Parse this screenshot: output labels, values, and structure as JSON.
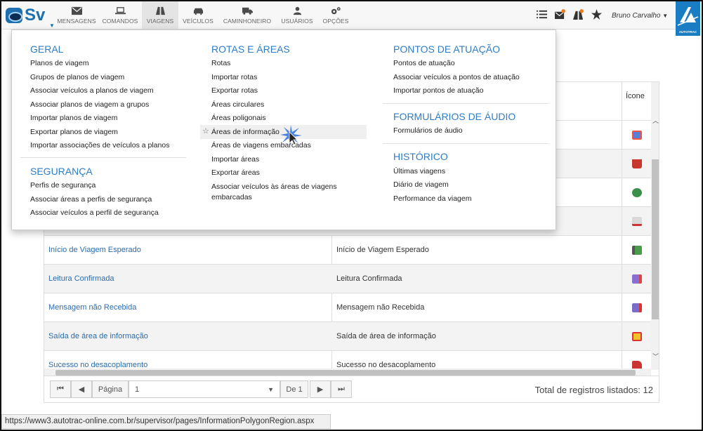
{
  "nav": {
    "logo_text": "Sv",
    "items": [
      {
        "label": "MENSAGENS",
        "icon": "envelope-icon"
      },
      {
        "label": "COMANDOS",
        "icon": "laptop-icon"
      },
      {
        "label": "VIAGENS",
        "icon": "road-icon"
      },
      {
        "label": "VEÍCULOS",
        "icon": "car-icon"
      },
      {
        "label": "CAMINHONEIRO",
        "icon": "truck-icon"
      },
      {
        "label": "USUÁRIOS",
        "icon": "user-icon"
      },
      {
        "label": "OPÇÕES",
        "icon": "gears-icon"
      }
    ],
    "user_name": "Bruno Carvalho",
    "brand_text": "AUTOTRAC"
  },
  "menu": {
    "geral": {
      "title": "GERAL",
      "items": [
        "Planos de viagem",
        "Grupos de planos de viagem",
        "Associar veículos a planos de viagem",
        "Associar planos de viagem a grupos",
        "Importar planos de viagem",
        "Exportar planos de viagem",
        "Importar associações de veículos a planos"
      ]
    },
    "seguranca": {
      "title": "SEGURANÇA",
      "items": [
        "Perfis de segurança",
        "Associar áreas a perfis de segurança",
        "Associar veículos a perfil de segurança"
      ]
    },
    "rotas": {
      "title": "ROTAS E ÁREAS",
      "items": [
        "Rotas",
        "Importar rotas",
        "Exportar rotas",
        "Áreas circulares",
        "Áreas poligonais",
        "Áreas de informação",
        "Áreas de viagens embarcadas",
        "Importar áreas",
        "Exportar áreas",
        "Associar veículos às áreas de viagens",
        "embarcadas"
      ]
    },
    "pontos": {
      "title": "PONTOS DE ATUAÇÃO",
      "items": [
        "Pontos de atuação",
        "Associar veículos a pontos de atuação",
        "Importar pontos de atuação"
      ]
    },
    "formularios": {
      "title": "FORMULÁRIOS DE ÁUDIO",
      "items": [
        "Formulários de áudio"
      ]
    },
    "historico": {
      "title": "HISTÓRICO",
      "items": [
        "Últimas viagens",
        "Diário de viagem",
        "Performance da viagem"
      ]
    }
  },
  "table": {
    "icon_header": "Ícone",
    "rows": [
      {
        "name": "Início de Viagem Esperado",
        "desc": "Início de Viagem Esperado"
      },
      {
        "name": "Leitura Confirmada",
        "desc": "Leitura Confirmada"
      },
      {
        "name": "Mensagem não Recebida",
        "desc": "Mensagem não Recebida"
      },
      {
        "name": "Saída de área de informação",
        "desc": "Saída de área de informação"
      },
      {
        "name": "Sucesso no desacoplamento",
        "desc": "Sucesso no desacoplamento"
      }
    ]
  },
  "pager": {
    "page_label": "Página",
    "page_value": "1",
    "of_label": "De 1",
    "total_text": "Total de registros listados: 12"
  },
  "status_url": "https://www3.autotrac-online.com.br/supervisor/pages/InformationPolygonRegion.aspx",
  "colors": {
    "accent": "#2d7dc6",
    "link": "#2a6cb0",
    "brand": "#1a7dc4"
  }
}
